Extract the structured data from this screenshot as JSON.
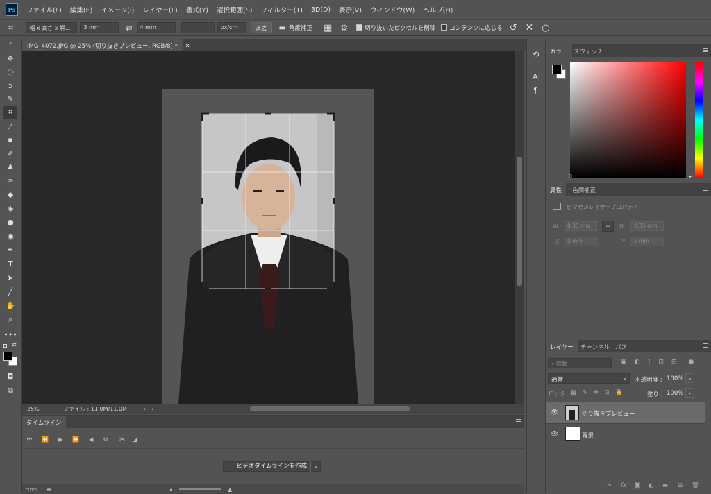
{
  "app": {
    "logo": "Ps"
  },
  "menu": [
    "ファイル(F)",
    "編集(E)",
    "イメージ(I)",
    "レイヤー(L)",
    "書式(Y)",
    "選択範囲(S)",
    "フィルター(T)",
    "3D(D)",
    "表示(V)",
    "ウィンドウ(W)",
    "ヘルプ(H)"
  ],
  "options": {
    "preset": "幅 x 高さ x 解...",
    "width": "3 mm",
    "height": "4 mm",
    "resolution": "",
    "unit": "px/cm",
    "clear_label": "消去",
    "straighten_label": "角度補正",
    "delete_pixels_label": "切り抜いたピクセルを削除",
    "delete_pixels_checked": true,
    "content_aware_label": "コンテンツに応じる",
    "content_aware_checked": false
  },
  "document": {
    "tab_title": "IMG_4072.JPG @ 25% (切り抜きプレビュー, RGB/8) *",
    "zoom": "25%",
    "file_info": "ファイル : 11.0M/11.0M"
  },
  "timeline": {
    "tab": "タイムライン",
    "create_button": "ビデオタイムラインを作成"
  },
  "color_panel": {
    "tabs": [
      "カラー",
      "スウォッチ"
    ],
    "foreground": "#000000",
    "background": "#ffffff"
  },
  "properties_panel": {
    "tabs": [
      "属性",
      "色調補正"
    ],
    "title": "ピクセルレイヤープロパティ",
    "w_label": "W :",
    "w_value": "0.35 mm",
    "h_label": "H :",
    "h_value": "0.35 mm",
    "x_label": "X :",
    "x_value": "0 mm",
    "y_label": "Y :",
    "y_value": "0 mm"
  },
  "layers_panel": {
    "tabs": [
      "レイヤー",
      "チャンネル",
      "パス"
    ],
    "filter_placeholder": "種類",
    "blend_mode": "通常",
    "opacity_label": "不透明度 :",
    "opacity_value": "100%",
    "lock_label": "ロック :",
    "fill_label": "塗り :",
    "fill_value": "100%",
    "layers": [
      {
        "name": "切り抜きプレビュー",
        "selected": true
      },
      {
        "name": "背景",
        "selected": false
      }
    ]
  }
}
